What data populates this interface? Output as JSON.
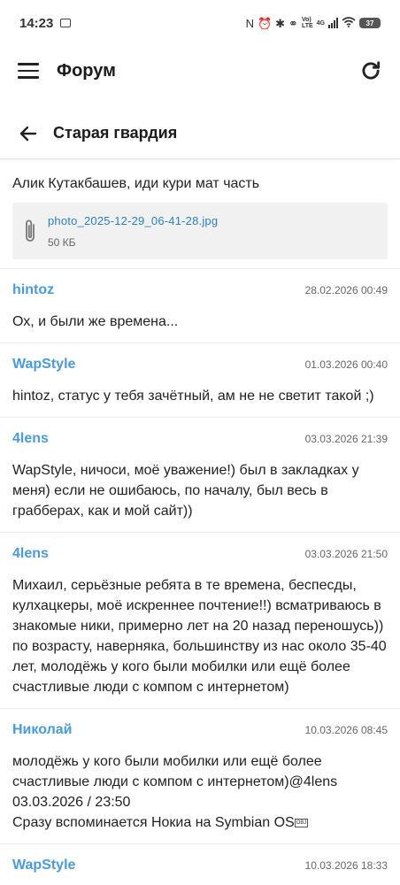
{
  "status": {
    "time": "14:23",
    "net_top": "Vo)",
    "net_bottom": "LTE",
    "net_gen": "4G",
    "battery": "37"
  },
  "app_bar": {
    "title": "Форум"
  },
  "sub_bar": {
    "title": "Старая гвардия"
  },
  "first_post": {
    "text": "Алик Кутакбашев, иди кури мат часть",
    "attachment": {
      "name": "photo_2025-12-29_06-41-28.jpg",
      "size": "50 КБ"
    }
  },
  "posts": [
    {
      "author": "hintoz",
      "date": "28.02.2026 00:49",
      "text": "Ох, и были же времена..."
    },
    {
      "author": "WapStyle",
      "date": "01.03.2026 00:40",
      "text": "hintoz, статус у тебя зачётный, ам не не светит такой ;)"
    },
    {
      "author": "4lens",
      "date": "03.03.2026 21:39",
      "text": "WapStyle, ничоси, моё уважение!) был в закладках у меня) если не ошибаюсь, по началу, был весь в грабберах, как и мой сайт))"
    },
    {
      "author": "4lens",
      "date": "03.03.2026 21:50",
      "text": "Михаил, серьёзные ребята в те времена, беспесды, кулхацкеры, моё искреннее почтение!!) всматриваюсь в знакомые ники, примерно лет на 20 назад переношусь)) по возрасту, наверняка, большинству из нас около 35-40 лет, молодёжь у кого были мобилки или ещё более счастливые люди с компом с интернетом)"
    },
    {
      "author": "Николай",
      "date": "10.03.2026 08:45",
      "text": "молодёжь у кого были мобилки или ещё более счастливые люди с компом с интернетом)@4lens 03.03.2026 / 23:50",
      "text2": "Сразу вспоминается Нокиа на Symbian OS",
      "obj": "OBJ"
    },
    {
      "author": "WapStyle",
      "date": "10.03.2026 18:33",
      "text": ""
    }
  ],
  "colors": {
    "author": "#4a9bd7",
    "link": "#2d7fc0",
    "attachment_bg": "#f1f1f1"
  }
}
